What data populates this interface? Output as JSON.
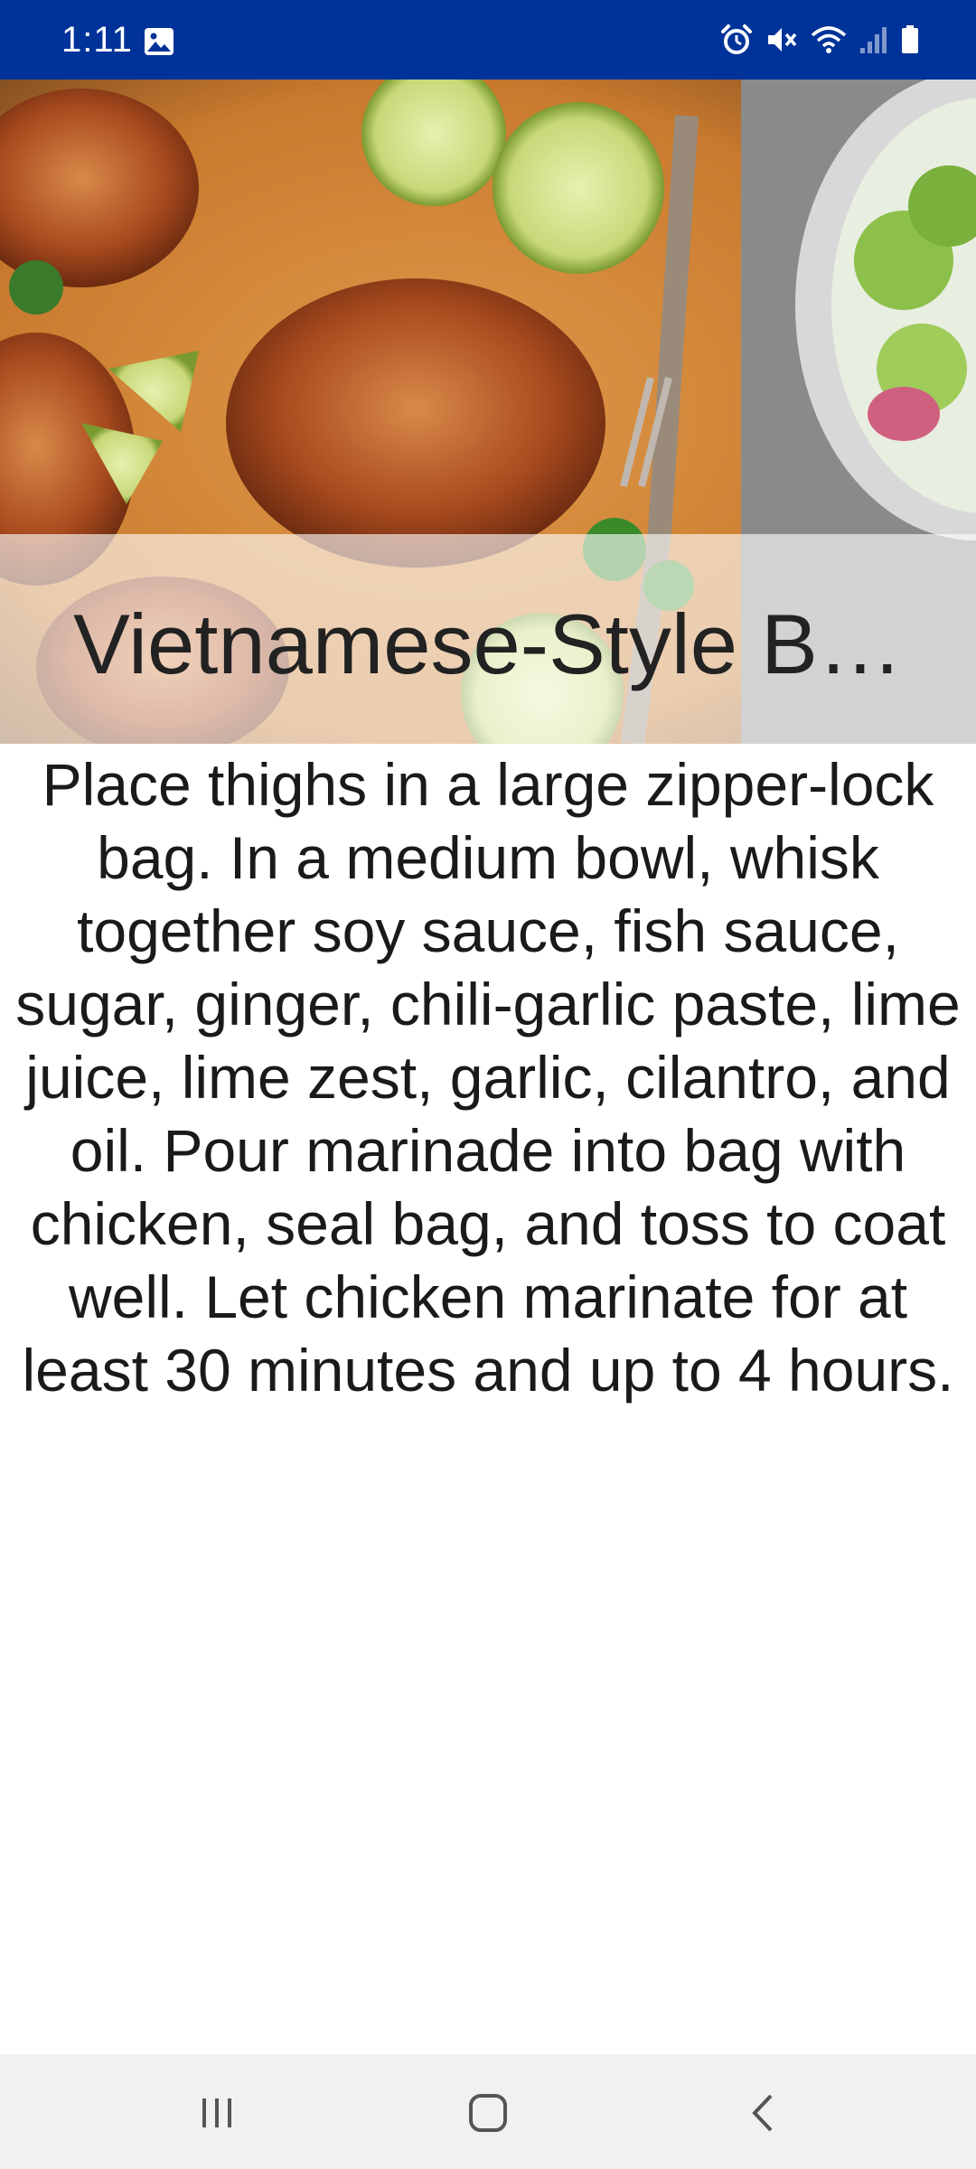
{
  "status_bar": {
    "time": "1:11",
    "background_color": "#003399",
    "icons": [
      "gallery-icon",
      "alarm-icon",
      "mute-icon",
      "wifi-icon",
      "signal-icon",
      "battery-icon"
    ]
  },
  "recipe": {
    "title": "Vietnamese-Style B…",
    "instructions": "Place thighs in a large zipper-lock bag. In a medium bowl, whisk together soy sauce, fish sauce, sugar, ginger, chili-garlic paste, lime juice, lime zest, garlic, cilantro, and oil. Pour marinade into bag with chicken, seal bag, and toss to coat well. Let chicken marinate for at least 30 minutes and up to 4 hours."
  },
  "nav_bar": {
    "buttons": [
      "recent-apps-icon",
      "home-icon",
      "back-icon"
    ]
  }
}
